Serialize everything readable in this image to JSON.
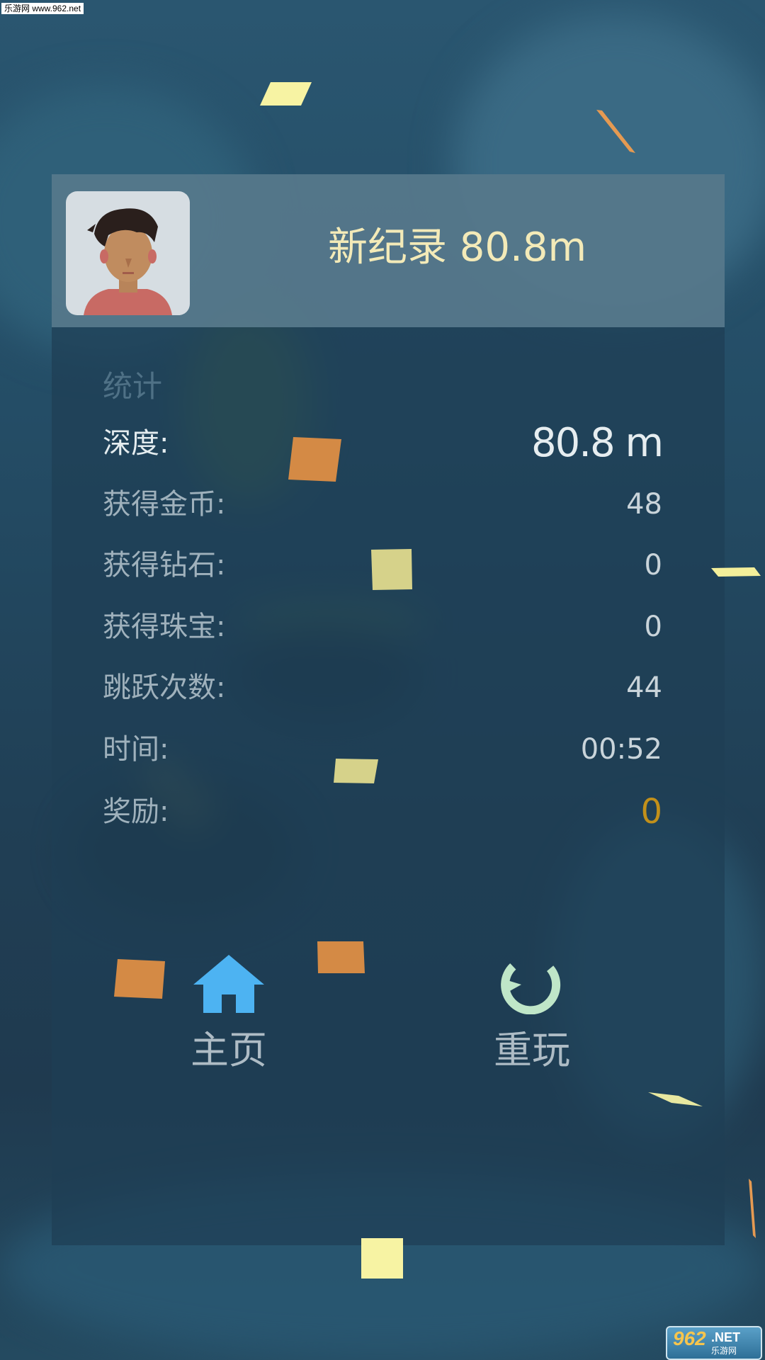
{
  "watermark": "乐游网 www.962.net",
  "header": {
    "record_text": "新纪录 80.8m"
  },
  "stats": {
    "title": "统计",
    "rows": [
      {
        "label": "深度:",
        "value": "80.8 m"
      },
      {
        "label": "获得金币:",
        "value": "48"
      },
      {
        "label": "获得钻石:",
        "value": "0"
      },
      {
        "label": "获得珠宝:",
        "value": "0"
      },
      {
        "label": "跳跃次数:",
        "value": "44"
      },
      {
        "label": "时间:",
        "value": "00:52"
      },
      {
        "label": "奖励:",
        "value": "0"
      }
    ]
  },
  "buttons": {
    "home": {
      "label": "主页",
      "icon": "home-icon"
    },
    "replay": {
      "label": "重玩",
      "icon": "replay-icon"
    }
  },
  "logo": {
    "brand": "962",
    "suffix": ".NET",
    "cn": "乐游网"
  },
  "colors": {
    "record_text": "#f3eab8",
    "home_icon": "#4db3f2",
    "replay_icon": "#bfe6c8",
    "reward_value": "#c2901a",
    "confetti_orange": "#d48a45",
    "confetti_yellow": "#f7f3a3"
  }
}
